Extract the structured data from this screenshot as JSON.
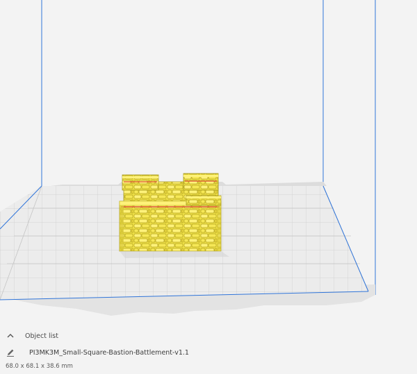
{
  "viewport": {
    "colors": {
      "background": "#f3f3f3",
      "build_volume_edge": "#2f74d9",
      "build_plate": "#e7e7e7",
      "grid_line": "#c7c7c7",
      "model_fill": "#f2e34a",
      "model_highlight": "#fff27a",
      "model_shadow": "#c9b92a",
      "model_dark": "#a89a1e",
      "model_red_edge": "#e0563a"
    }
  },
  "object_panel": {
    "collapse_icon": "chevron-up-icon",
    "header_label": "Object list",
    "edit_icon": "pencil-icon",
    "object_name": "PI3MK3M_Small-Square-Bastion-Battlement-v1.1",
    "dimensions": "68.0 x 68.1 x 38.6 mm"
  }
}
